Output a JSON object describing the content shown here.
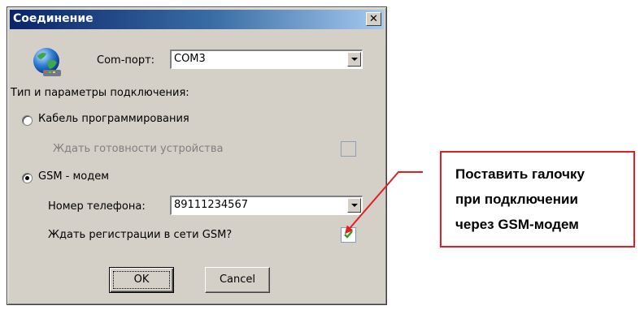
{
  "dialog": {
    "title": "Соединение",
    "close_label": "✕",
    "com_port": {
      "label": "Com-порт:",
      "value": "COM3"
    },
    "connection_type_label": "Тип и параметры подключения:",
    "cable": {
      "label": "Кабель программирования",
      "checked": false
    },
    "wait_ready": {
      "label": "Ждать готовности устройства",
      "checked": false,
      "enabled": false
    },
    "gsm": {
      "label": "GSM - модем",
      "checked": true
    },
    "phone": {
      "label": "Номер телефона:",
      "value": "89111234567"
    },
    "wait_gsm": {
      "label": "Ждать регистрации в сети GSM?",
      "checked": true
    },
    "ok_label": "OK",
    "cancel_label": "Cancel"
  },
  "callout": {
    "lines": [
      "Поставить галочку",
      "при подключении",
      "через GSM-модем"
    ],
    "border_color": "#e31e24"
  }
}
